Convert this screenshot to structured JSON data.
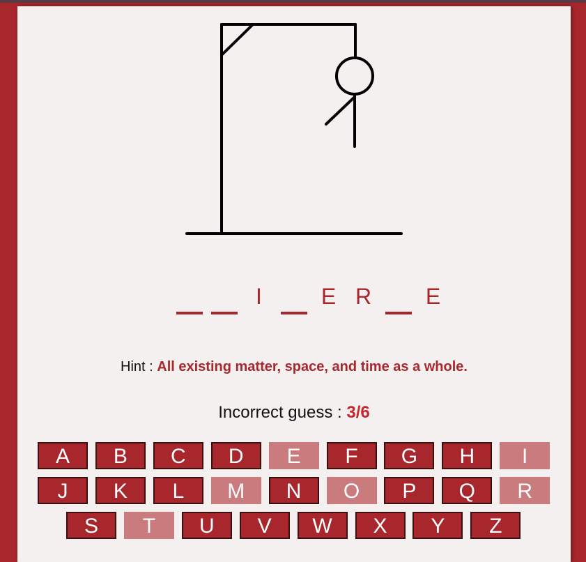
{
  "word": [
    {
      "letter": "",
      "revealed": false
    },
    {
      "letter": "",
      "revealed": false
    },
    {
      "letter": "I",
      "revealed": true
    },
    {
      "letter": "",
      "revealed": false
    },
    {
      "letter": "E",
      "revealed": true
    },
    {
      "letter": "R",
      "revealed": true
    },
    {
      "letter": "",
      "revealed": false
    },
    {
      "letter": "E",
      "revealed": true
    }
  ],
  "hint": {
    "label": "Hint : ",
    "text": "All existing matter, space, and time as a whole."
  },
  "incorrect": {
    "label": "Incorrect guess : ",
    "value": "3/6"
  },
  "keyboard": {
    "rows": [
      [
        "A",
        "B",
        "C",
        "D",
        "E",
        "F",
        "G",
        "H",
        "I"
      ],
      [
        "J",
        "K",
        "L",
        "M",
        "N",
        "O",
        "P",
        "Q",
        "R"
      ],
      [
        "S",
        "T",
        "U",
        "V",
        "W",
        "X",
        "Y",
        "Z"
      ]
    ],
    "used": [
      "E",
      "I",
      "M",
      "O",
      "R",
      "T"
    ]
  },
  "colors": {
    "accent": "#a8272d",
    "used": "#c97b7e",
    "background": "#f4f0f0"
  }
}
